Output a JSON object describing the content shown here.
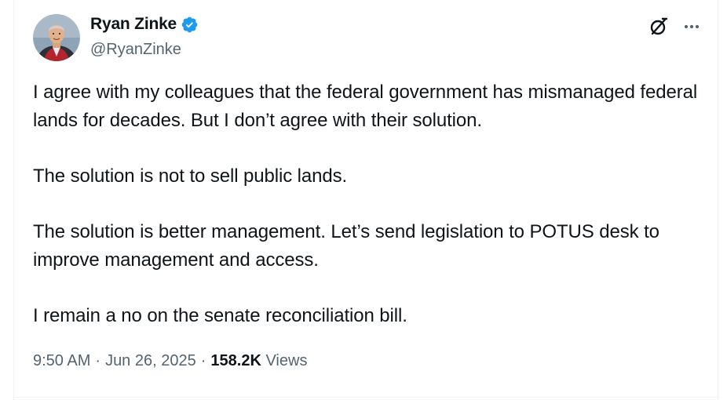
{
  "author": {
    "name": "Ryan Zinke",
    "handle": "@RyanZinke",
    "verified": true
  },
  "tweet": {
    "paragraphs": [
      "I agree with my colleagues that the federal government has mismanaged federal lands for decades. But I don’t agree with their solution.",
      "The solution is not to sell public lands.",
      "The solution is better management. Let’s send legislation to POTUS desk to improve management and access.",
      "I remain a no on the senate reconciliation bill."
    ],
    "time": "9:50 AM",
    "date": "Jun 26, 2025",
    "views_count": "158.2K",
    "views_label": "Views",
    "separator": "·"
  },
  "icons": {
    "verified": "verified-badge-icon",
    "grok": "grok-icon",
    "more": "more-options-icon"
  },
  "colors": {
    "text_primary": "#0f1419",
    "text_secondary": "#536471",
    "verified_blue": "#1d9bf0",
    "border": "#eff3f4"
  }
}
